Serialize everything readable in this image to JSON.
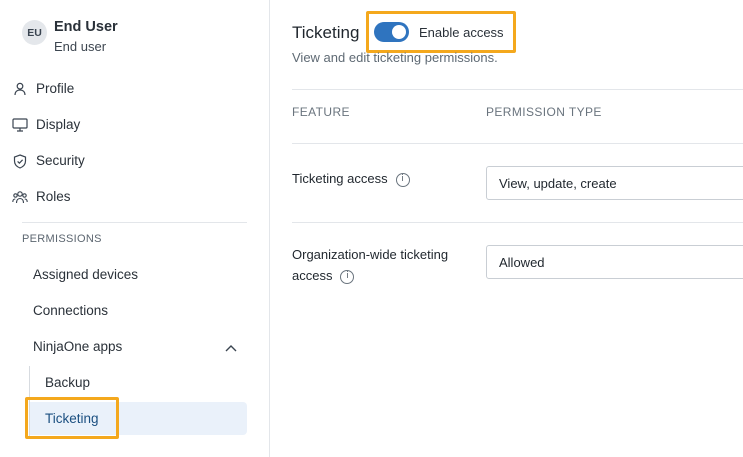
{
  "user": {
    "initials": "EU",
    "name": "End User",
    "role": "End user"
  },
  "nav": [
    {
      "label": "Profile",
      "icon": "person-icon"
    },
    {
      "label": "Display",
      "icon": "monitor-icon"
    },
    {
      "label": "Security",
      "icon": "shield-icon"
    },
    {
      "label": "Roles",
      "icon": "users-icon"
    }
  ],
  "permissions": {
    "section_label": "PERMISSIONS",
    "items": [
      "Assigned devices",
      "Connections",
      "NinjaOne apps"
    ],
    "subitems": [
      "Backup",
      "Ticketing"
    ],
    "active_subitem": "Ticketing"
  },
  "main": {
    "title": "Ticketing",
    "toggle": {
      "label": "Enable access",
      "on": true
    },
    "subtitle": "View and edit ticketing permissions.",
    "columns": [
      "FEATURE",
      "PERMISSION TYPE"
    ],
    "rows": [
      {
        "feature": "Ticketing access",
        "permission": "View, update, create"
      },
      {
        "feature_line1": "Organization-wide ticketing",
        "feature_line2": "access",
        "permission": "Allowed"
      }
    ]
  },
  "colors": {
    "accent": "#2f74bf",
    "highlight": "#f4a81d",
    "active_bg": "#eaf1fa",
    "active_text": "#1b4f80"
  }
}
